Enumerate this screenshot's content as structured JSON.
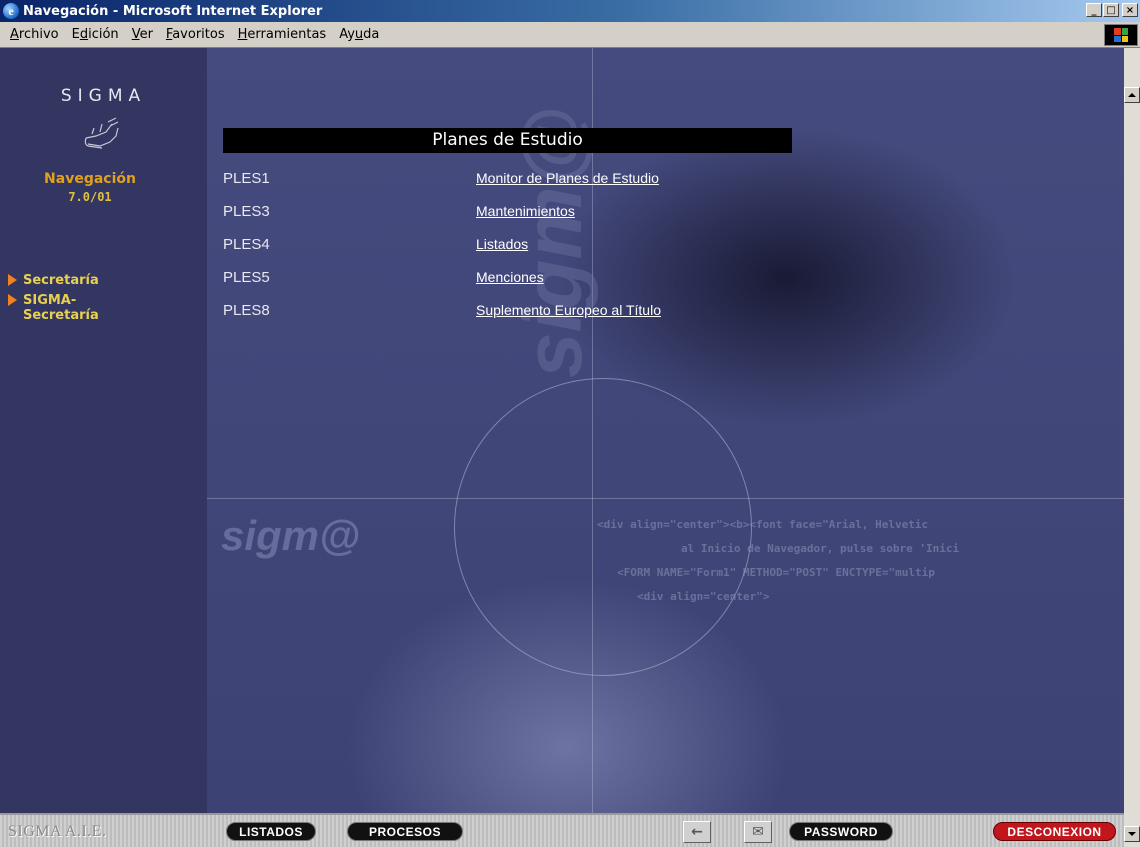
{
  "window": {
    "title": "Navegación - Microsoft Internet Explorer",
    "buttons": [
      "_",
      "□",
      "×"
    ]
  },
  "menu": [
    {
      "prefix": "",
      "mnemonic": "A",
      "rest": "rchivo"
    },
    {
      "prefix": "E",
      "mnemonic": "d",
      "rest": "ición"
    },
    {
      "prefix": "",
      "mnemonic": "V",
      "rest": "er"
    },
    {
      "prefix": "",
      "mnemonic": "F",
      "rest": "avoritos"
    },
    {
      "prefix": "",
      "mnemonic": "H",
      "rest": "erramientas"
    },
    {
      "prefix": "Ay",
      "mnemonic": "u",
      "rest": "da"
    }
  ],
  "sidebar": {
    "logo": "SIGMA",
    "title": "Navegación",
    "version": "7.0/01",
    "links": [
      {
        "label": "Secretaría"
      },
      {
        "label_line1": "SIGMA-",
        "label_line2": "Secretaría"
      }
    ]
  },
  "main": {
    "heading": "Planes de Estudio",
    "plans": [
      {
        "code": "PLES1",
        "label": "Monitor de Planes de Estudio"
      },
      {
        "code": "PLES3",
        "label": "Mantenimientos"
      },
      {
        "code": "PLES4",
        "label": "Listados"
      },
      {
        "code": "PLES5",
        "label": "Menciones"
      },
      {
        "code": "PLES8",
        "label": "Suplemento Europeo al Título"
      }
    ],
    "watermark": {
      "vertical": "sigm@",
      "horizontal": "sigm@",
      "code_lines": [
        "<div align=\"center\"><b><font face=\"Arial, Helvetic",
        "al Inicio de Navegador, pulse sobre 'Inici",
        "<FORM NAME=\"Form1\" METHOD=\"POST\" ENCTYPE=\"multip",
        "<div align=\"center\">"
      ]
    }
  },
  "bottombar": {
    "company": "SIGMA A.I.E.",
    "listados": "LISTADOS",
    "procesos": "PROCESOS",
    "back_icon": "←",
    "mail_icon": "✉",
    "password": "PASSWORD",
    "desconexion": "DESCONEXION"
  }
}
